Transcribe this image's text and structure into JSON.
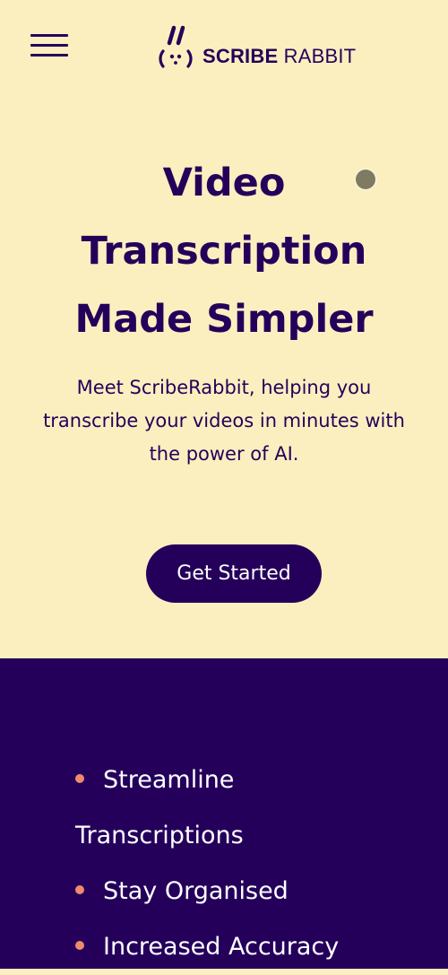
{
  "header": {
    "menu_icon": "hamburger-menu-icon",
    "logo": {
      "mark_icon": "rabbit-face-icon",
      "word1": "SCRIBE",
      "word2": "RABBIT"
    }
  },
  "hero": {
    "title": "Video Transcription Made Simpler",
    "subtitle": "Meet ScribeRabbit, helping you transcribe your videos in minutes with the power of AI.",
    "cta_label": "Get Started"
  },
  "features": {
    "items": [
      {
        "line1": "Streamline",
        "line2": "Transcriptions"
      },
      {
        "line1": "Stay Organised"
      },
      {
        "line1": "Increased Accuracy"
      }
    ]
  },
  "colors": {
    "hero_background": "#fbefc0",
    "brand_dark": "#25005a",
    "features_background": "#24005b",
    "bullet": "#f08a6c",
    "button_text": "#ffffff"
  }
}
